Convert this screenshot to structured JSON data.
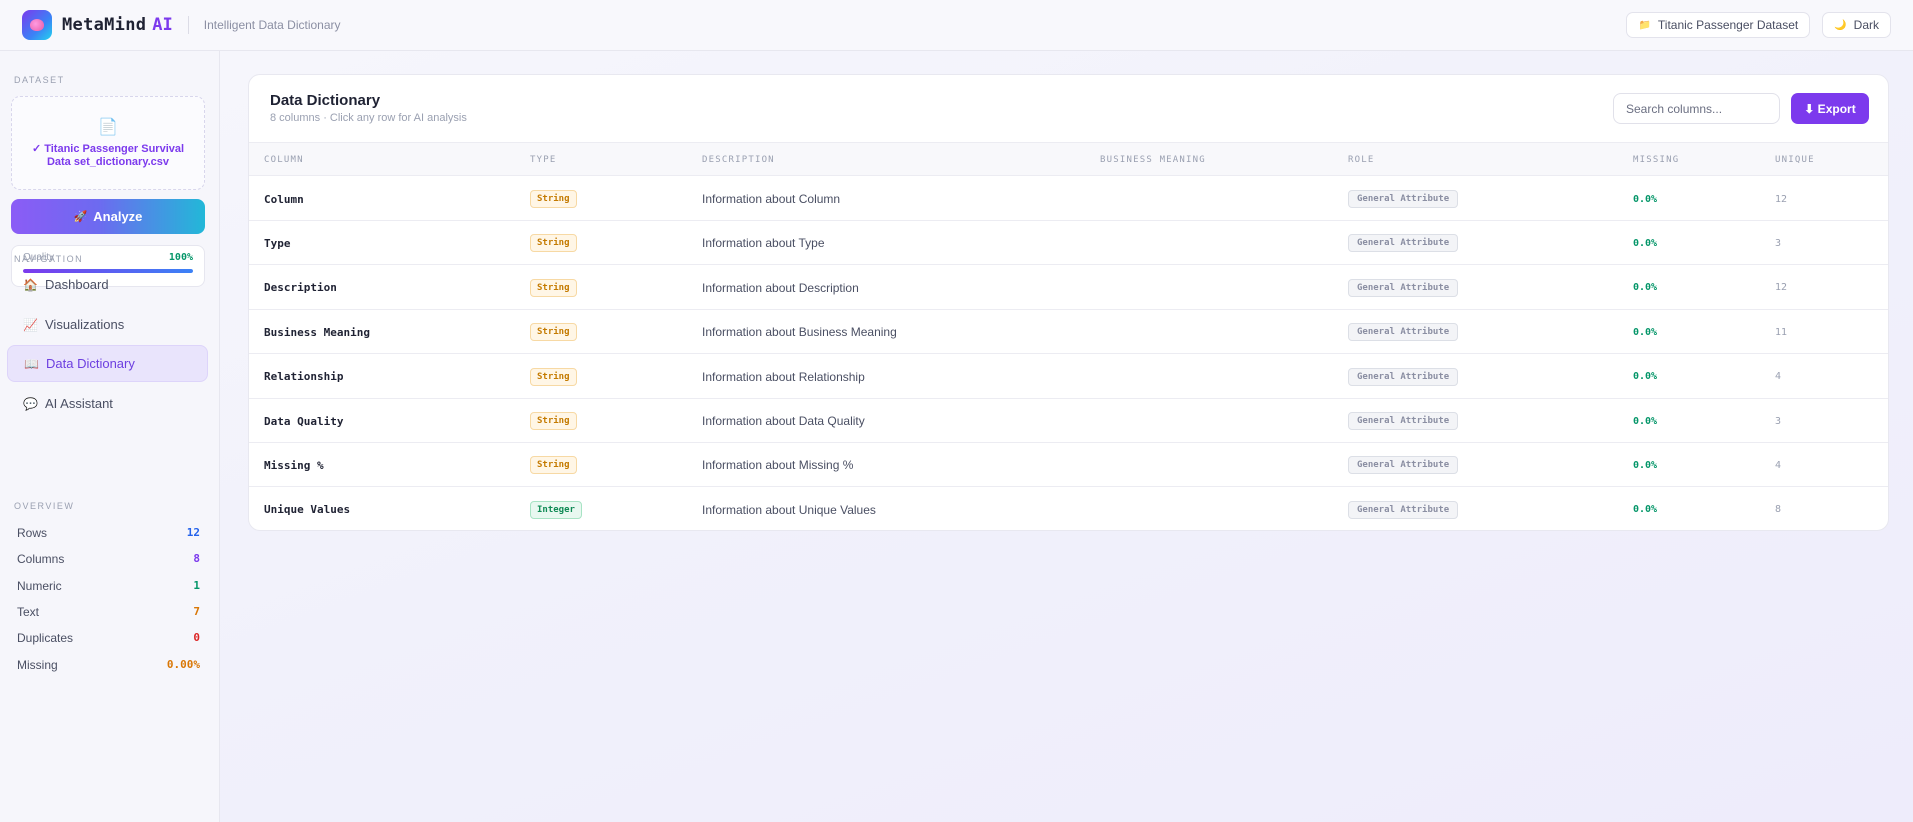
{
  "header": {
    "brand": "MetaMind",
    "brand_accent": "AI",
    "tagline": "Intelligent Data Dictionary",
    "dataset_pill": "Titanic Passenger Dataset",
    "dataset_icon": "folder-icon",
    "theme_toggle": "Dark",
    "theme_icon": "moon-icon"
  },
  "sidebar": {
    "dataset_label": "DATASET",
    "file_icon": "document-icon",
    "file_name": "✓ Titanic Passenger Survival Data set_dictionary.csv",
    "analyze_label": "Analyze",
    "quality": {
      "label": "Quality",
      "value": "100%",
      "fraction": 1.0
    },
    "nav_label": "NAVIGATION",
    "nav": [
      {
        "label": "Dashboard",
        "icon": "🏠"
      },
      {
        "label": "Visualizations",
        "icon": "📈"
      },
      {
        "label": "Data Dictionary",
        "icon": "📖"
      },
      {
        "label": "AI Assistant",
        "icon": "💬"
      }
    ],
    "overview_label": "OVERVIEW",
    "overview": [
      {
        "label": "Rows",
        "value": "12",
        "color": "#2563eb"
      },
      {
        "label": "Columns",
        "value": "8",
        "color": "#7c3aed"
      },
      {
        "label": "Numeric",
        "value": "1",
        "color": "#059669"
      },
      {
        "label": "Text",
        "value": "7",
        "color": "#d97706"
      },
      {
        "label": "Duplicates",
        "value": "0",
        "color": "#dc2626"
      },
      {
        "label": "Missing",
        "value": "0.00%",
        "color": "#d97706"
      }
    ]
  },
  "main": {
    "title": "Data Dictionary",
    "subtitle": "8 columns · Click any row for AI analysis",
    "search_placeholder": "Search columns...",
    "export_label": "⬇ Export",
    "columns": [
      "COLUMN",
      "TYPE",
      "DESCRIPTION",
      "BUSINESS MEANING",
      "ROLE",
      "MISSING",
      "UNIQUE"
    ],
    "rows": [
      {
        "column": "Column",
        "type": "String",
        "description": "Information about Column",
        "business_meaning": "",
        "role": "General Attribute",
        "missing": "0.0%",
        "unique": "12"
      },
      {
        "column": "Type",
        "type": "String",
        "description": "Information about Type",
        "business_meaning": "",
        "role": "General Attribute",
        "missing": "0.0%",
        "unique": "3"
      },
      {
        "column": "Description",
        "type": "String",
        "description": "Information about Description",
        "business_meaning": "",
        "role": "General Attribute",
        "missing": "0.0%",
        "unique": "12"
      },
      {
        "column": "Business Meaning",
        "type": "String",
        "description": "Information about Business Meaning",
        "business_meaning": "",
        "role": "General Attribute",
        "missing": "0.0%",
        "unique": "11"
      },
      {
        "column": "Relationship",
        "type": "String",
        "description": "Information about Relationship",
        "business_meaning": "",
        "role": "General Attribute",
        "missing": "0.0%",
        "unique": "4"
      },
      {
        "column": "Data Quality",
        "type": "String",
        "description": "Information about Data Quality",
        "business_meaning": "",
        "role": "General Attribute",
        "missing": "0.0%",
        "unique": "3"
      },
      {
        "column": "Missing %",
        "type": "String",
        "description": "Information about Missing %",
        "business_meaning": "",
        "role": "General Attribute",
        "missing": "0.0%",
        "unique": "4"
      },
      {
        "column": "Unique Values",
        "type": "Integer",
        "description": "Information about Unique Values",
        "business_meaning": "",
        "role": "General Attribute",
        "missing": "0.0%",
        "unique": "8"
      }
    ]
  }
}
